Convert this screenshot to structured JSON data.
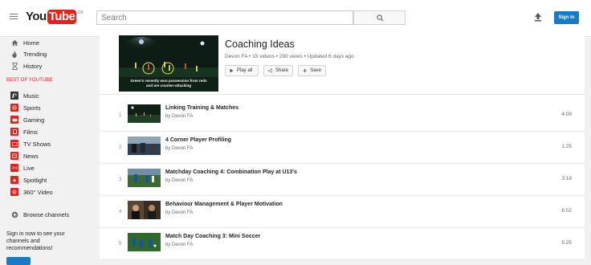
{
  "header": {
    "logo_you": "You",
    "logo_tube": "Tube",
    "logo_region": "GB",
    "search_placeholder": "Search",
    "signin_label": "Sign in"
  },
  "sidebar": {
    "nav": [
      {
        "label": "Home",
        "icon": "home-icon"
      },
      {
        "label": "Trending",
        "icon": "flame-icon"
      },
      {
        "label": "History",
        "icon": "hourglass-icon"
      }
    ],
    "section_label": "BEST OF YOUTUBE",
    "channels": [
      {
        "label": "Music",
        "icon": "music-icon"
      },
      {
        "label": "Sports",
        "icon": "sports-icon"
      },
      {
        "label": "Gaming",
        "icon": "gaming-icon"
      },
      {
        "label": "Films",
        "icon": "films-icon"
      },
      {
        "label": "TV Shows",
        "icon": "tv-icon"
      },
      {
        "label": "News",
        "icon": "news-icon"
      },
      {
        "label": "Live",
        "icon": "live-icon"
      },
      {
        "label": "Spotlight",
        "icon": "spotlight-icon"
      },
      {
        "label": "360° Video",
        "icon": "360-icon"
      }
    ],
    "browse_label": "Browse channels",
    "signin_note": "Sign in now to see your channels and recommendations!"
  },
  "playlist": {
    "title": "Coaching Ideas",
    "meta": "Devon FA • 15 videos • 290 views • Updated 6 days ago",
    "thumb_caption": "Green's recently won possession from reds and are counter-attacking",
    "buttons": {
      "play_all": "Play all",
      "share": "Share",
      "save": "Save"
    },
    "videos": [
      {
        "index": "1",
        "title": "Linking Training & Matches",
        "by": "by Devon FA",
        "duration": "4:09"
      },
      {
        "index": "2",
        "title": "4 Corner Player Profiling",
        "by": "by Devon FA",
        "duration": "1:25"
      },
      {
        "index": "3",
        "title": "Matchday Coaching 4: Combination Play at U13's",
        "by": "by Devon FA",
        "duration": "3:18"
      },
      {
        "index": "4",
        "title": "Behaviour Management & Player Motivation",
        "by": "by Devon FA",
        "duration": "6:02"
      },
      {
        "index": "5",
        "title": "Match Day Coaching 3: Mini Soccer",
        "by": "by Devon FA",
        "duration": "5:25"
      }
    ]
  },
  "colors": {
    "brand_red": "#e62117",
    "signin_blue": "#167ac6",
    "page_bg": "#f1f1f1"
  }
}
